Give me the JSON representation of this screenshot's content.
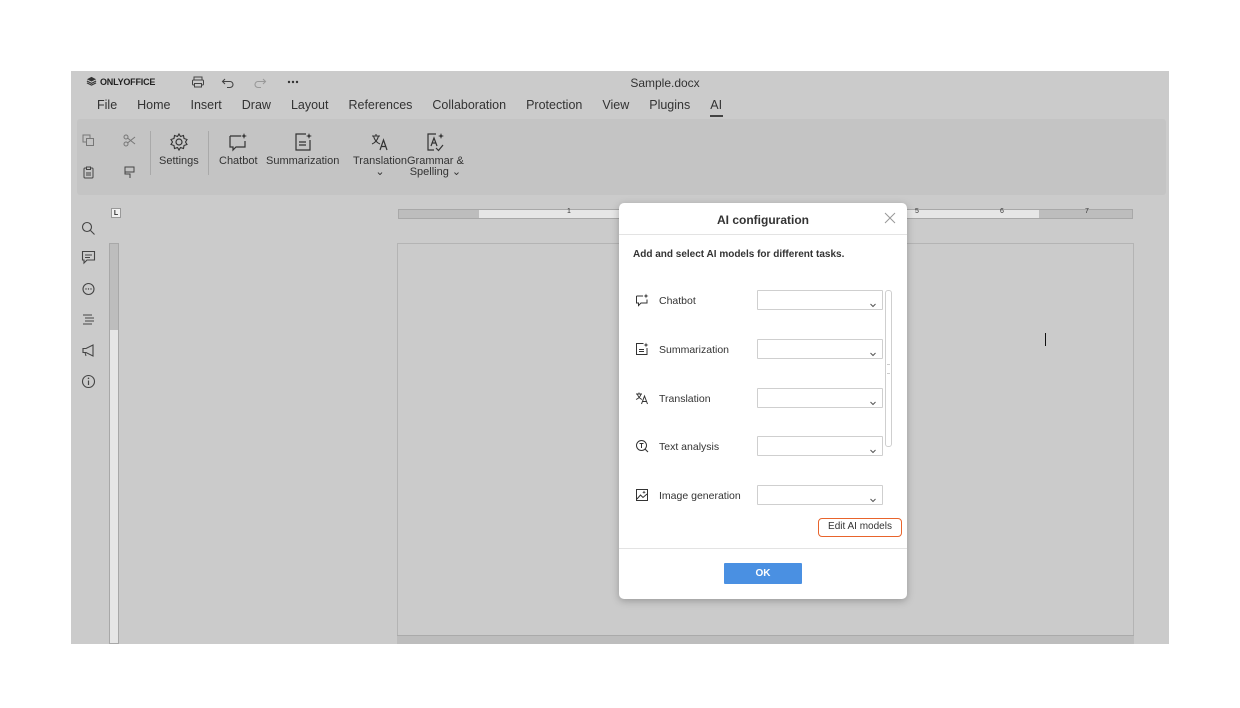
{
  "app": {
    "brand": "ONLYOFFICE",
    "title": "Sample.docx"
  },
  "menu": {
    "tabs": [
      {
        "label": "File"
      },
      {
        "label": "Home"
      },
      {
        "label": "Insert"
      },
      {
        "label": "Draw"
      },
      {
        "label": "Layout"
      },
      {
        "label": "References"
      },
      {
        "label": "Collaboration"
      },
      {
        "label": "Protection"
      },
      {
        "label": "View"
      },
      {
        "label": "Plugins"
      },
      {
        "label": "AI"
      }
    ],
    "active": "AI"
  },
  "ribbon": {
    "settings": "Settings",
    "chatbot": "Chatbot",
    "summarization": "Summarization",
    "translation": "Translation",
    "translation_arrow": "⌄",
    "grammar_line1": "Grammar &",
    "grammar_line2": "Spelling ⌄"
  },
  "ruler": {
    "corner": "L",
    "numbers": [
      "1",
      "5",
      "6",
      "7"
    ]
  },
  "dialog": {
    "title": "AI configuration",
    "description": "Add and select AI models for different tasks.",
    "rows": [
      {
        "label": "Chatbot",
        "icon": "chatbot-icon",
        "value": ""
      },
      {
        "label": "Summarization",
        "icon": "summarization-icon",
        "value": ""
      },
      {
        "label": "Translation",
        "icon": "translation-icon",
        "value": ""
      },
      {
        "label": "Text analysis",
        "icon": "text-analysis-icon",
        "value": ""
      },
      {
        "label": "Image generation",
        "icon": "image-generation-icon",
        "value": ""
      }
    ],
    "edit_button": "Edit AI models",
    "ok_button": "OK"
  },
  "colors": {
    "accent": "#4a90e2",
    "highlight": "#e8642c",
    "background": "#cbcbcb"
  }
}
